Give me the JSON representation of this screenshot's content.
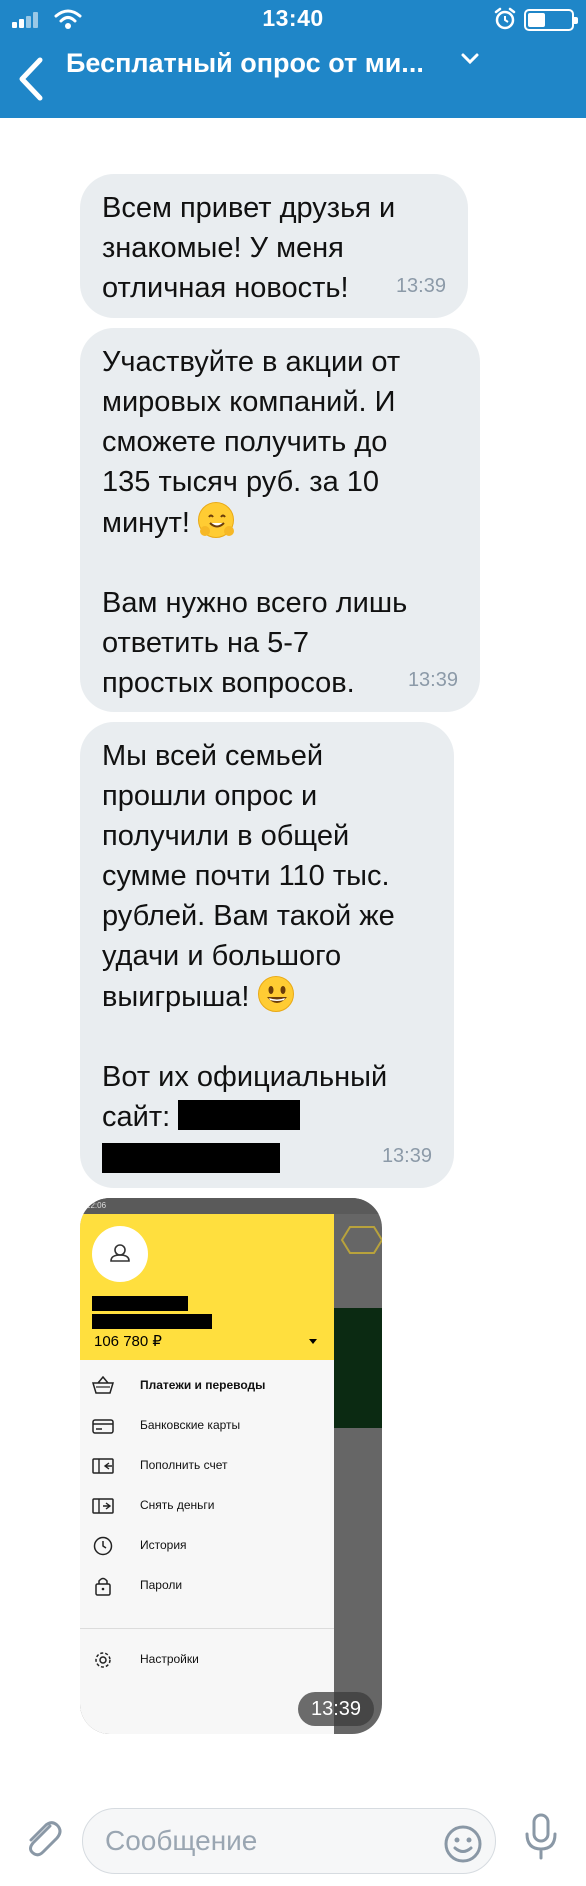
{
  "status_bar": {
    "time": "13:40"
  },
  "header": {
    "title": "Бесплатный опрос от ми..."
  },
  "messages": [
    {
      "text": "Всем привет друзья и\nзнакомые! У меня\nотличная новость!",
      "time": "13:39"
    },
    {
      "text_1": "Участвуйте в акции от\nмировых компаний. И\nсможете получить до\n135 тысяч руб. за 10\nминут!",
      "emoji": "hugging-face",
      "text_2": "Вам нужно всего лишь\nответить на 5-7\nпростых вопросов.",
      "time": "13:39"
    },
    {
      "text_1": "Мы всей семьей\nпрошли опрос и\nполучили в общей\nсумме почти 110 тыс.\nрублей. Вам такой же\nудачи и большого\nвыигрыша!",
      "emoji": "grinning-face",
      "text_2": "Вот их официальный\nсайт:",
      "time": "13:39"
    }
  ],
  "image_message": {
    "time": "13:39",
    "screenshot": {
      "status_time": "12:06",
      "balance": "106 780 ₽",
      "menu": [
        {
          "label": "Платежи и переводы",
          "icon": "basket-icon",
          "bold": true
        },
        {
          "label": "Банковские карты",
          "icon": "card-icon",
          "bold": false
        },
        {
          "label": "Пополнить счет",
          "icon": "topup-icon",
          "bold": false
        },
        {
          "label": "Снять деньги",
          "icon": "withdraw-icon",
          "bold": false
        },
        {
          "label": "История",
          "icon": "clock-icon",
          "bold": false
        },
        {
          "label": "Пароли",
          "icon": "lock-icon",
          "bold": false
        },
        {
          "label": "Настройки",
          "icon": "gear-icon",
          "bold": false
        }
      ]
    }
  },
  "composer": {
    "placeholder": "Сообщение"
  },
  "colors": {
    "header": "#1f86c8",
    "bubble": "#e9edf0",
    "drawer_header": "#ffdf3e",
    "time": "#8c9aa8"
  }
}
